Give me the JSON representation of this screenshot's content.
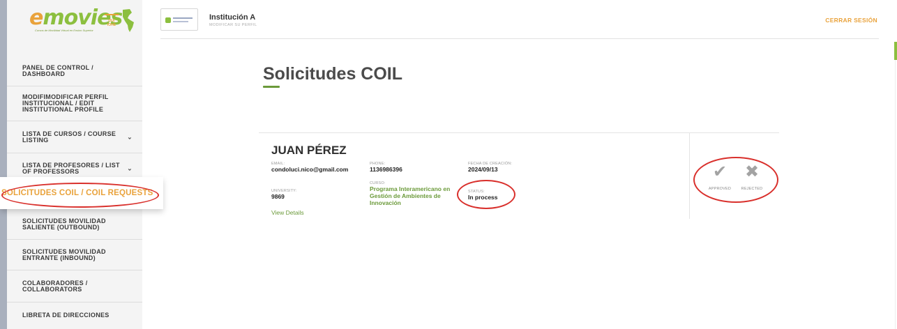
{
  "brand": {
    "logo_text_e": "e",
    "logo_text_rest": "movies",
    "logo_tagline": "Cursos de Movilidad Virtual en Ensino Superior",
    "logo_partner": "OUI IOHE",
    "accent_color": "#e9a23b",
    "green_color": "#8cbf3f"
  },
  "sidebar": {
    "items": [
      {
        "label": "PANEL DE CONTROL / DASHBOARD"
      },
      {
        "label": "MODIFIMODIFICAR PERFIL INSTITUCIONAL / EDIT INSTITUTIONAL PROFILE"
      },
      {
        "label": "LISTA DE CURSOS / COURSE LISTING",
        "icon": "chevron-down-icon"
      },
      {
        "label": "LISTA DE PROFESORES / LIST OF PROFESSORS",
        "icon": "chevron-down-icon"
      },
      {
        "label": "SOLICITUDES COIL / COIL REQUESTS",
        "active": true
      },
      {
        "label": "SOLICITUDES MOVILIDAD SALIENTE (OUTBOUND)"
      },
      {
        "label": "SOLICITUDES MOVILIDAD ENTRANTE (INBOUND)"
      },
      {
        "label": "COLABORADORES / COLLABORATORS"
      },
      {
        "label": "LIBRETA DE DIRECCIONES"
      }
    ]
  },
  "header": {
    "institution_name": "Institución A",
    "edit_profile_label": "MODIFICAR SU PERFIL",
    "logout_label": "CERRAR SESIÓN"
  },
  "main": {
    "title": "Solicitudes COIL",
    "request": {
      "name": "JUAN PÉREZ",
      "email_label": "EMAIL:",
      "email": "condoluci.nico@gmail.com",
      "phone_label": "PHONE:",
      "phone": "1136986396",
      "created_label": "FECHA DE CREACIÓN:",
      "created": "2024/09/13",
      "university_label": "UNIVERSITY:",
      "university": "9869",
      "course_label": "CURSO:",
      "course": "Programa Interamericano en Gestión de Ambientes de Innovación",
      "status_label": "STATUS:",
      "status": "In process",
      "view_details": "View Details",
      "approve_label": "APPROVED",
      "reject_label": "REJECTED"
    }
  }
}
